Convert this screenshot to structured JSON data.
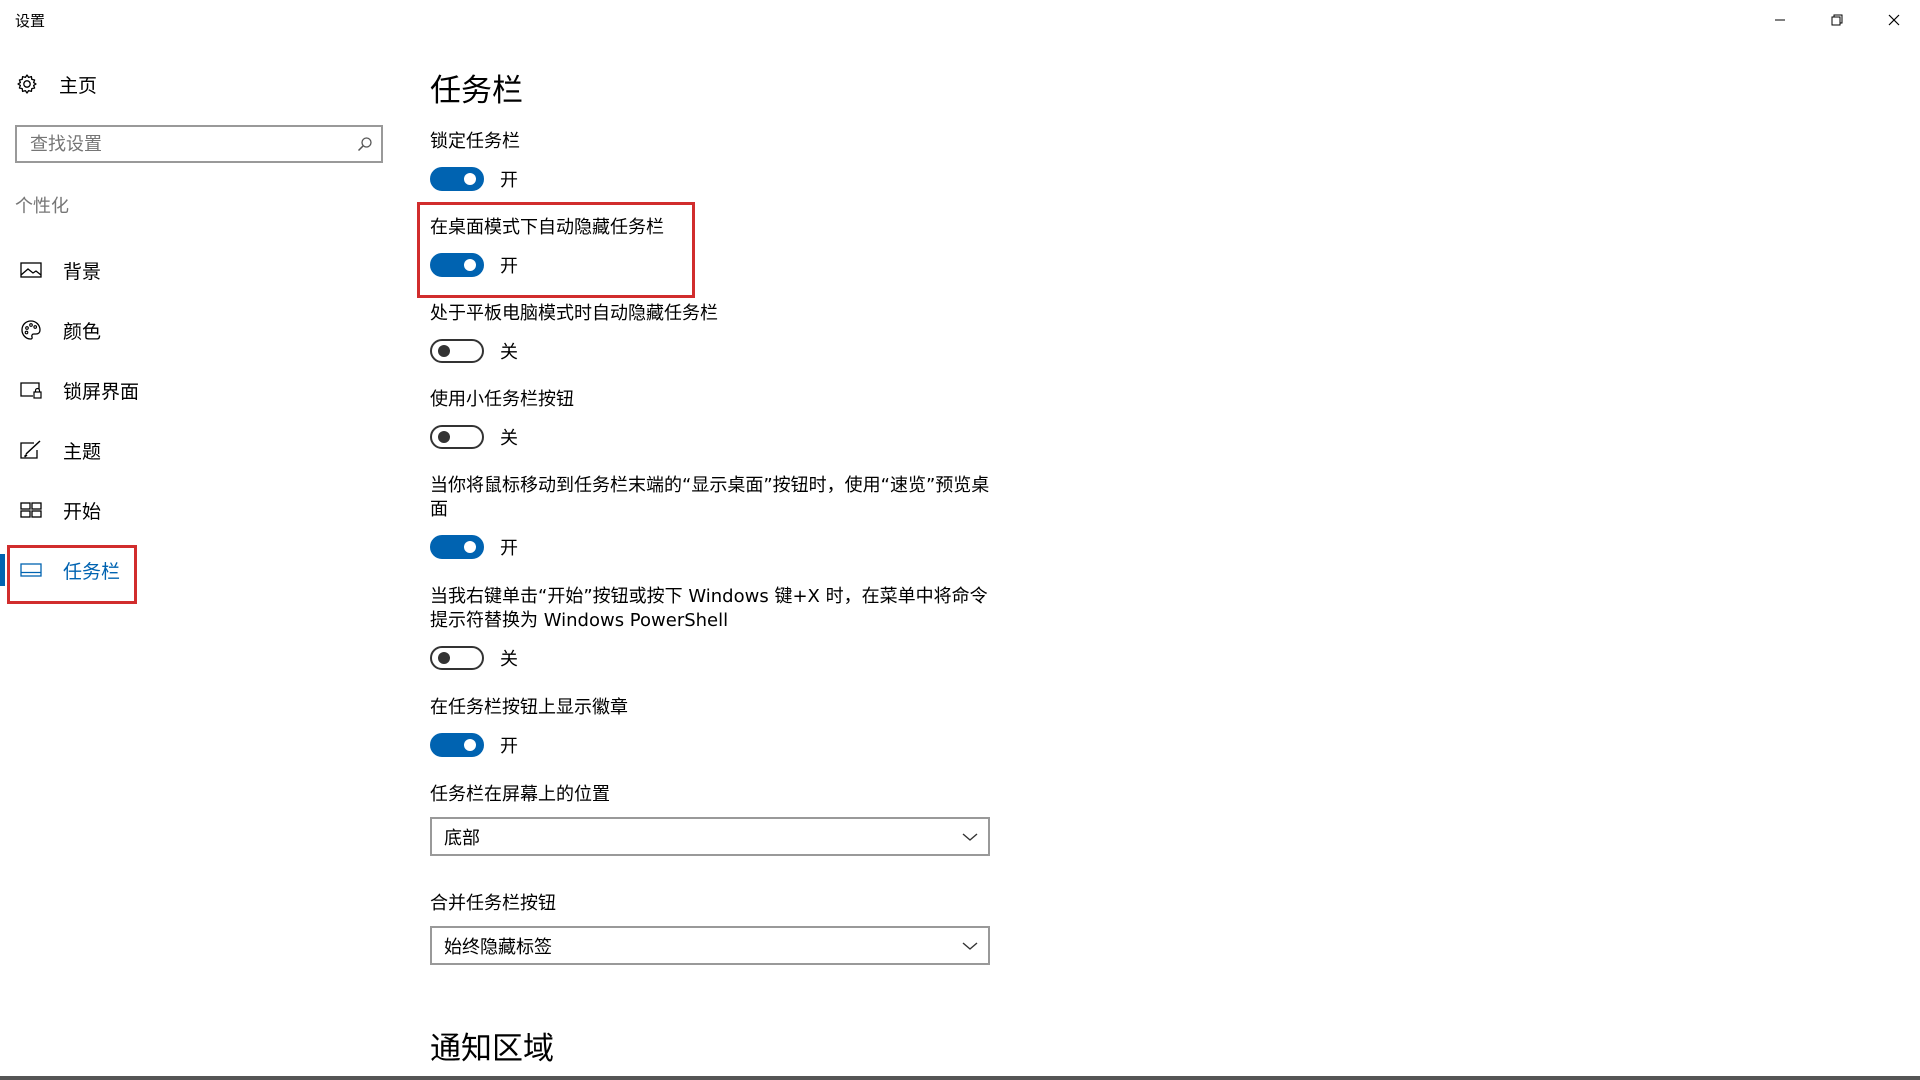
{
  "window": {
    "title": "设置"
  },
  "sidebar": {
    "home_label": "主页",
    "search_placeholder": "查找设置",
    "section_label": "个性化",
    "items": [
      {
        "label": "背景"
      },
      {
        "label": "颜色"
      },
      {
        "label": "锁屏界面"
      },
      {
        "label": "主题"
      },
      {
        "label": "开始"
      },
      {
        "label": "任务栏"
      }
    ],
    "active_item": "任务栏"
  },
  "main": {
    "page_title": "任务栏",
    "settings": [
      {
        "label": "锁定任务栏",
        "state": "开",
        "on": true
      },
      {
        "label": "在桌面模式下自动隐藏任务栏",
        "state": "开",
        "on": true
      },
      {
        "label": "处于平板电脑模式时自动隐藏任务栏",
        "state": "关",
        "on": false
      },
      {
        "label": "使用小任务栏按钮",
        "state": "关",
        "on": false
      },
      {
        "label": "当你将鼠标移动到任务栏末端的“显示桌面”按钮时，使用“速览”预览桌面",
        "state": "开",
        "on": true
      },
      {
        "label": "当我右键单击“开始”按钮或按下 Windows 键+X 时，在菜单中将命令提示符替换为 Windows PowerShell",
        "state": "关",
        "on": false
      },
      {
        "label": "在任务栏按钮上显示徽章",
        "state": "开",
        "on": true
      }
    ],
    "position_label": "任务栏在屏幕上的位置",
    "position_value": "底部",
    "combine_label": "合并任务栏按钮",
    "combine_value": "始终隐藏标签",
    "next_section_title": "通知区域"
  },
  "colors": {
    "accent": "#0063b1",
    "highlight": "#d12d2d",
    "secondary_text": "#767676",
    "border": "#999999"
  },
  "icons": {
    "home": "gear-icon",
    "search": "search-icon",
    "background": "picture-icon",
    "colors": "palette-icon",
    "lockscreen": "lockscreen-icon",
    "themes": "theme-brush-icon",
    "start": "start-tiles-icon",
    "taskbar": "taskbar-icon"
  }
}
